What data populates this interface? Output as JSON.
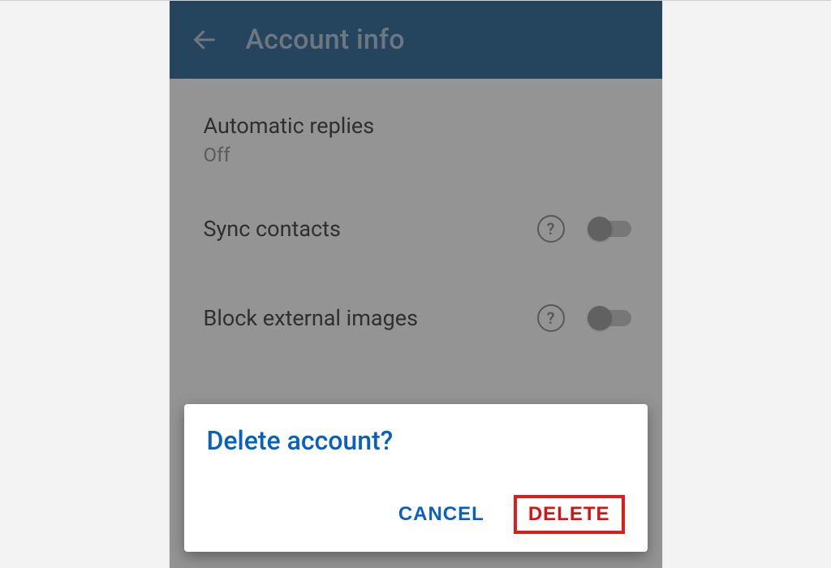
{
  "header": {
    "title": "Account info"
  },
  "settings": {
    "automatic_replies": {
      "label": "Automatic replies",
      "value": "Off"
    },
    "sync_contacts": {
      "label": "Sync contacts"
    },
    "block_external_images": {
      "label": "Block external images"
    }
  },
  "dialog": {
    "title": "Delete account?",
    "cancel": "CANCEL",
    "delete": "DELETE"
  },
  "help_glyph": "?"
}
